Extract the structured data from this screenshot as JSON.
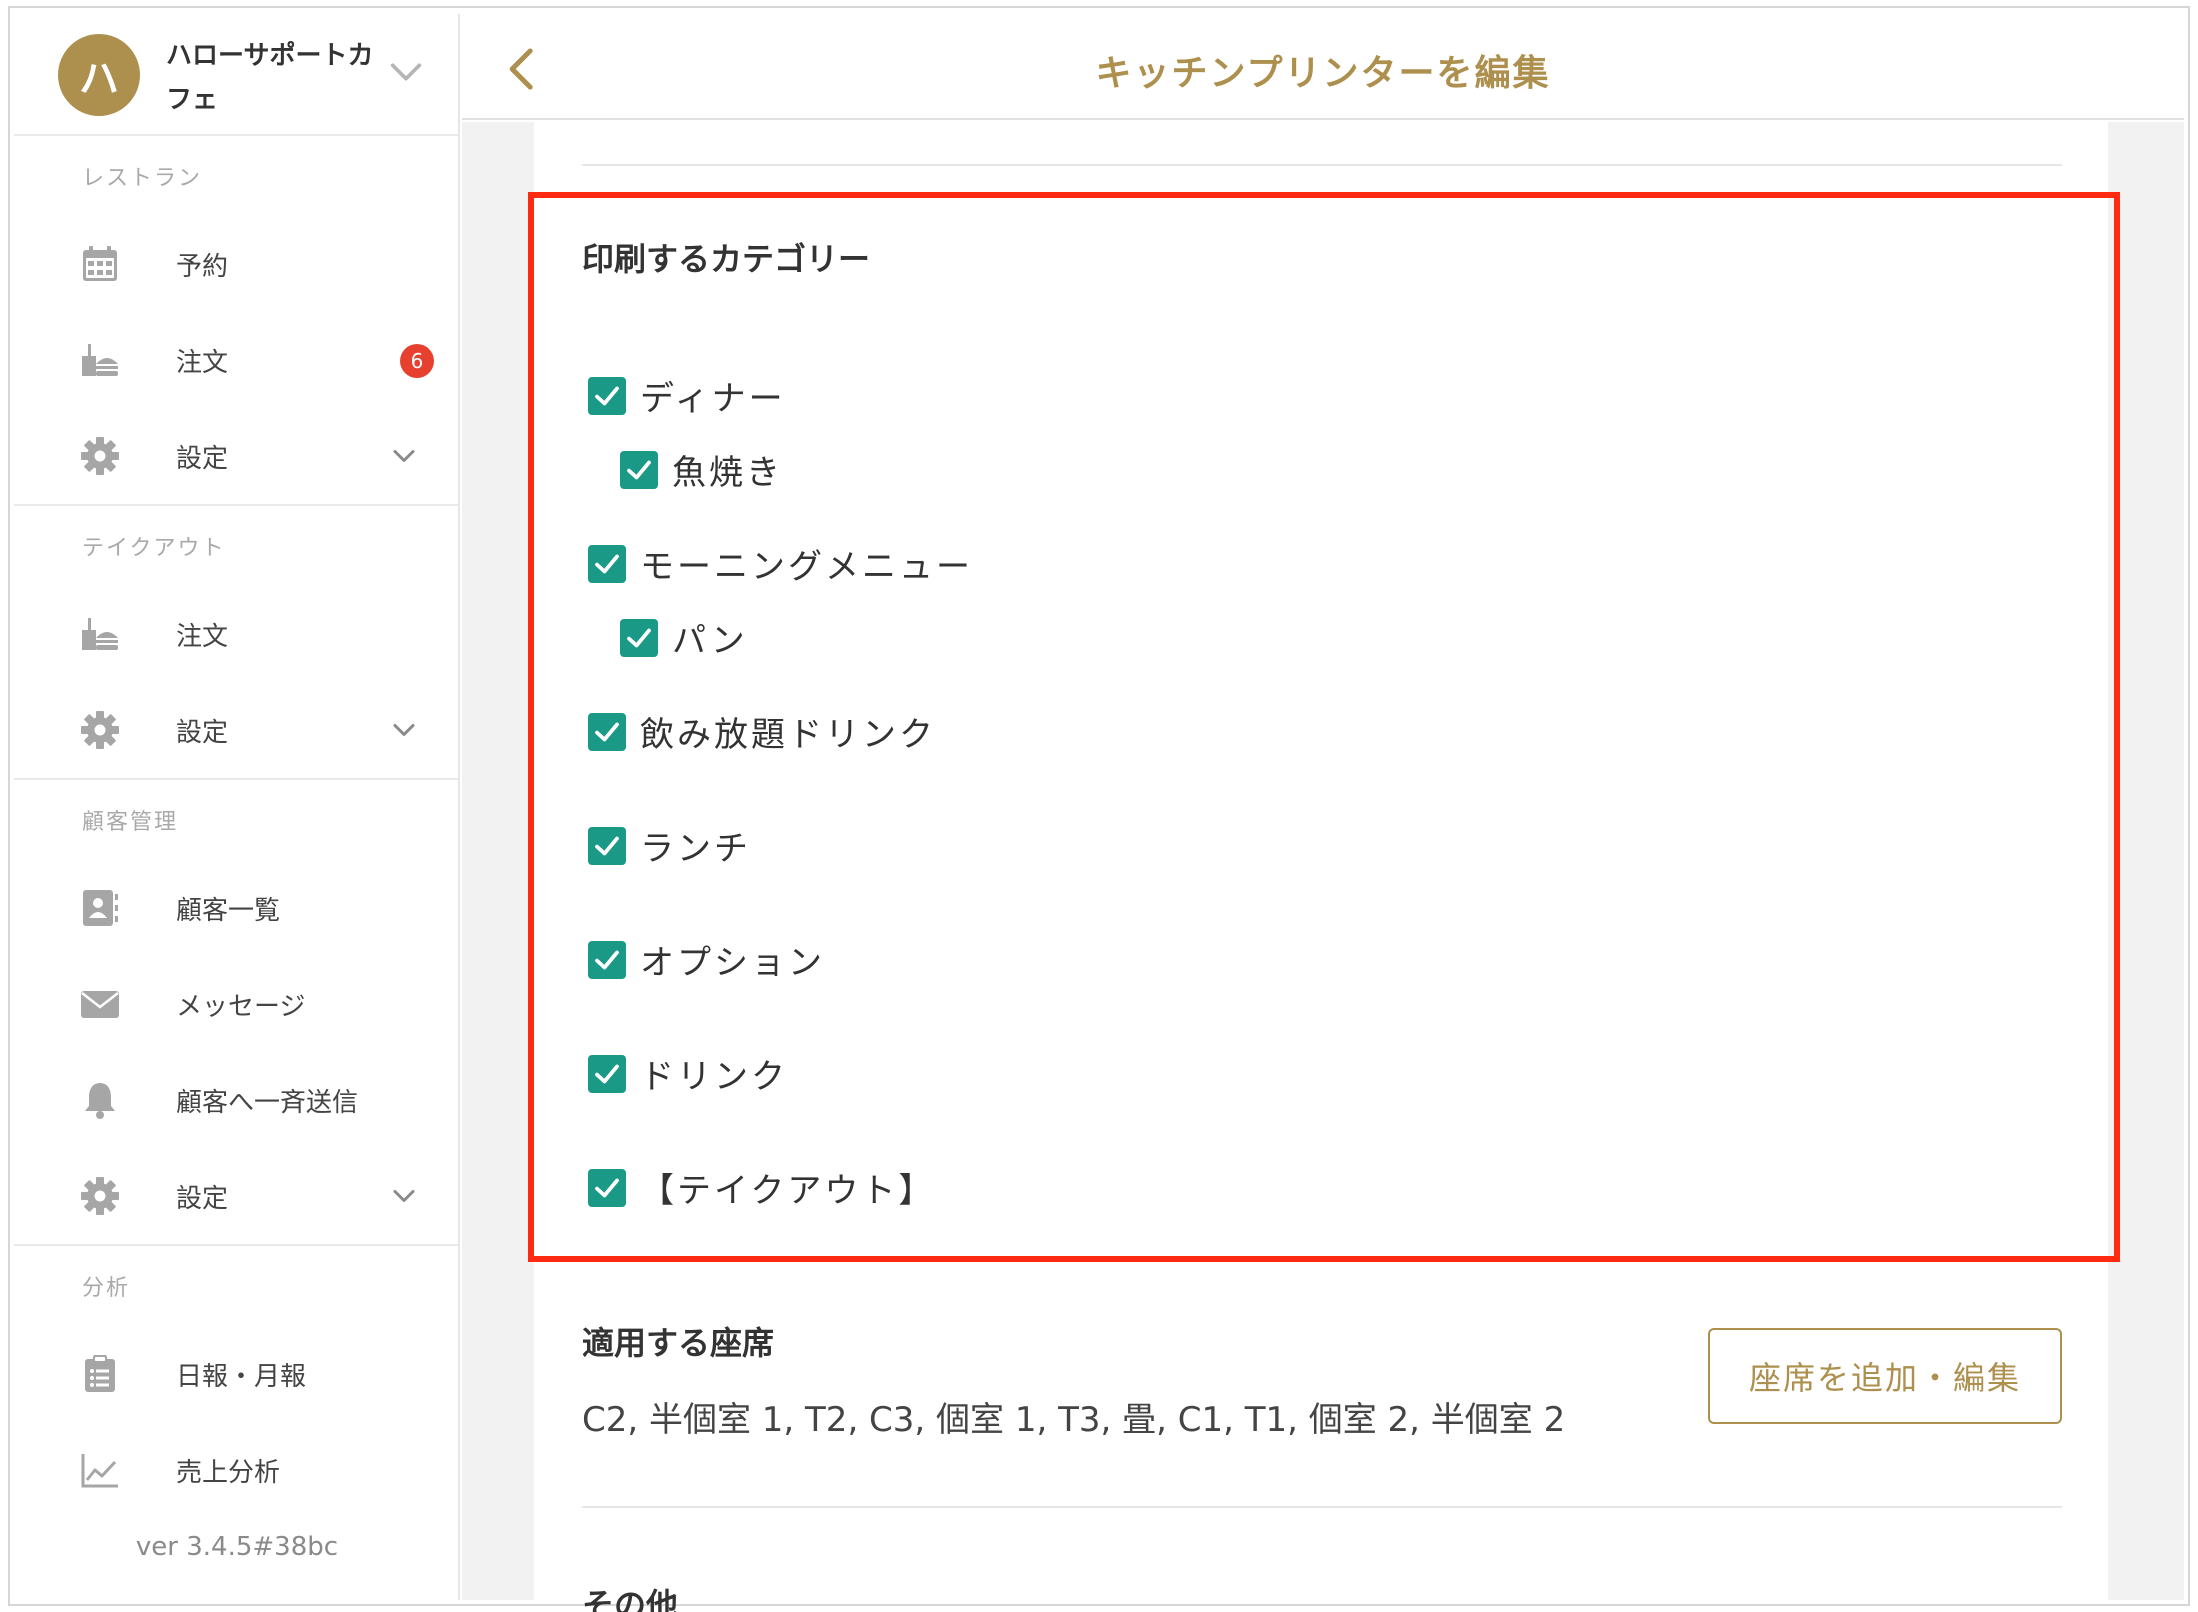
{
  "brand": {
    "avatar_letter": "ハ",
    "name": "ハローサポートカフェ"
  },
  "sidebar": {
    "sections": {
      "restaurant": "レストラン",
      "takeout": "テイクアウト",
      "customer": "顧客管理",
      "analysis": "分析"
    },
    "items": {
      "reservation": "予約",
      "restaurant_order": "注文",
      "restaurant_order_badge": "6",
      "restaurant_settings": "設定",
      "takeout_order": "注文",
      "takeout_settings": "設定",
      "customer_list": "顧客一覧",
      "messages": "メッセージ",
      "broadcast": "顧客へ一斉送信",
      "customer_settings": "設定",
      "daily_report": "日報・月報",
      "sales_analysis": "売上分析"
    },
    "version": "ver 3.4.5#38bc"
  },
  "header": {
    "title": "キッチンプリンターを編集"
  },
  "categories": {
    "title": "印刷するカテゴリー",
    "items": [
      {
        "label": "ディナー",
        "checked": true
      },
      {
        "label": "魚焼き",
        "checked": true
      },
      {
        "label": "モーニングメニュー",
        "checked": true
      },
      {
        "label": "パン",
        "checked": true
      },
      {
        "label": "飲み放題ドリンク",
        "checked": true
      },
      {
        "label": "ランチ",
        "checked": true
      },
      {
        "label": "オプション",
        "checked": true
      },
      {
        "label": "ドリンク",
        "checked": true
      },
      {
        "label": "【テイクアウト】",
        "checked": true
      }
    ]
  },
  "seats": {
    "title": "適用する座席",
    "list": "C2, 半個室 1, T2, C3, 個室 1, T3, 畳, C1, T1, 個室 2, 半個室 2",
    "button_label": "座席を追加・編集"
  },
  "other": {
    "title": "その他"
  },
  "colors": {
    "accent": "#ad8f4e",
    "checkbox": "#1a9a86",
    "badge": "#e8402f",
    "highlight": "#ff2a12"
  }
}
